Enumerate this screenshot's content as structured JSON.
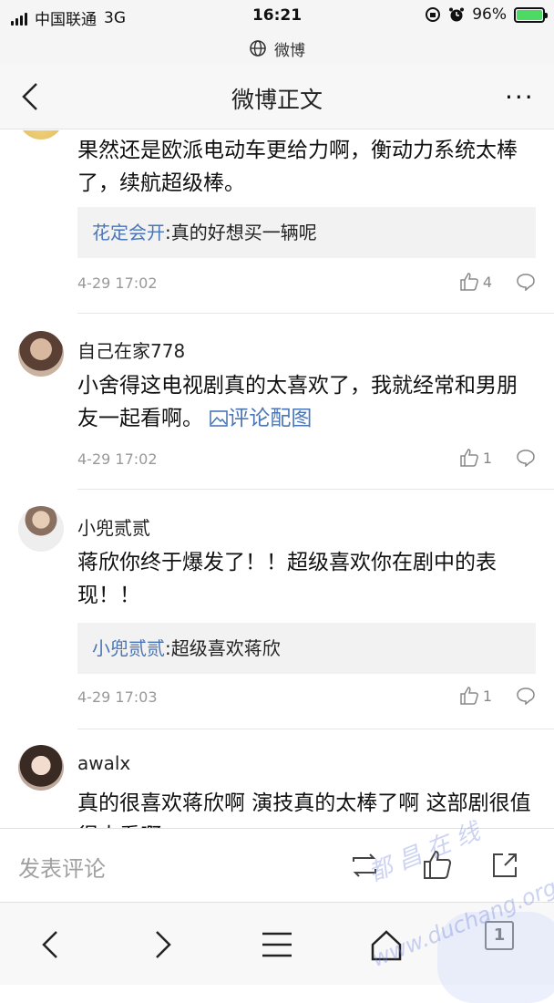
{
  "status_bar": {
    "carrier": "中国联通",
    "network": "3G",
    "time": "16:21",
    "battery": "96%"
  },
  "site_bar": {
    "title": "微博"
  },
  "nav": {
    "title": "微博正文",
    "more": "···"
  },
  "comments": [
    {
      "text": "果然还是欧派电动车更给力啊，衡动力系统太棒了，续航超级棒。",
      "quote_name": "花定会开",
      "quote_text": ":真的好想买一辆呢",
      "time": "4-29 17:02",
      "likes": "4"
    },
    {
      "username": "自己在家778",
      "text": "小舍得这电视剧真的太喜欢了，我就经常和男朋友一起看啊。",
      "link": "评论配图",
      "time": "4-29 17:02",
      "likes": "1"
    },
    {
      "username": "小兜贰贰",
      "text": "蒋欣你终于爆发了！！超级喜欢你在剧中的表现！！",
      "quote_name": "小兜贰贰",
      "quote_text": ":超级喜欢蒋欣",
      "time": "4-29 17:03",
      "likes": "1"
    },
    {
      "username": "awalx",
      "text": "真的很喜欢蒋欣啊 演技真的太棒了啊 这部剧很值得大看啊"
    }
  ],
  "comment_bar": {
    "placeholder": "发表评论"
  },
  "browser_bar": {
    "tab_count": "1"
  },
  "watermark": {
    "line1": "都 昌 在 线",
    "line2": "www.duchang.org"
  },
  "colors": {
    "link": "#4a76b8",
    "meta": "#999999",
    "battery": "#4cd964"
  }
}
